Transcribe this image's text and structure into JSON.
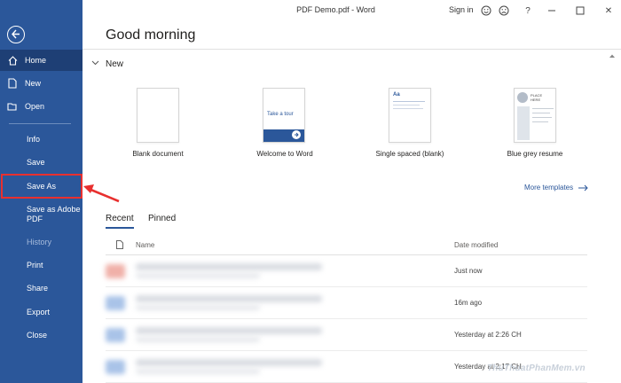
{
  "titlebar": {
    "title": "PDF Demo.pdf  -  Word",
    "signin": "Sign in",
    "icons": [
      "smile-icon",
      "frown-icon",
      "help-icon",
      "minimize-icon",
      "maximize-icon",
      "close-icon"
    ],
    "help_glyph": "?",
    "close_glyph": "✕"
  },
  "sidebar": {
    "items": [
      {
        "label": "Home",
        "icon": "home-icon"
      },
      {
        "label": "New",
        "icon": "new-document-icon"
      },
      {
        "label": "Open",
        "icon": "open-folder-icon"
      },
      {
        "label": "Info"
      },
      {
        "label": "Save"
      },
      {
        "label": "Save As"
      },
      {
        "label": "Save as Adobe\nPDF"
      },
      {
        "label": "History"
      },
      {
        "label": "Print"
      },
      {
        "label": "Share"
      },
      {
        "label": "Export"
      },
      {
        "label": "Close"
      }
    ],
    "active_item": "Home",
    "disabled_item": "History",
    "highlight_color": "#e8302f",
    "background": "#2b579a"
  },
  "main": {
    "greeting": "Good morning",
    "new_section": "New",
    "templates": [
      {
        "label": "Blank document"
      },
      {
        "label": "Welcome to Word",
        "thumb_text": "Take a tour"
      },
      {
        "label": "Single spaced (blank)",
        "thumb_text": "Aa"
      },
      {
        "label": "Blue grey resume",
        "thumb_text": "PLACE\nHERE"
      }
    ],
    "more_templates": "More templates",
    "tabs": [
      "Recent",
      "Pinned"
    ],
    "active_tab": "Recent",
    "columns": {
      "name": "Name",
      "date": "Date modified"
    },
    "recent_files": [
      {
        "date": "Just now",
        "icon_color": "#f0b0a8"
      },
      {
        "date": "16m ago",
        "icon_color": "#a9c3e8"
      },
      {
        "date": "Yesterday at 2:26 CH",
        "icon_color": "#a9c3e8"
      },
      {
        "date": "Yesterday at 2:17 CH",
        "icon_color": "#a9c3e8"
      }
    ]
  },
  "watermark": "ThuThuatPhanMem.vn"
}
